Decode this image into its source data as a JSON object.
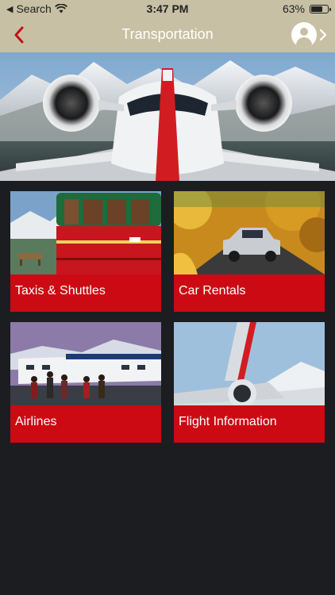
{
  "status_bar": {
    "back_app": "Search",
    "time": "3:47 PM",
    "battery_percent": "63%",
    "battery_level": 0.63
  },
  "nav": {
    "title": "Transportation"
  },
  "icons": {
    "back": "chevron-left-icon",
    "profile": "user-icon",
    "profile_arrow": "chevron-right-icon",
    "wifi": "wifi-icon",
    "battery": "battery-icon"
  },
  "colors": {
    "nav_background": "#c8c0a4",
    "accent_red": "#cc0a13",
    "page_background": "#1b1d20"
  },
  "tiles": [
    {
      "label": "Taxis & Shuttles"
    },
    {
      "label": "Car Rentals"
    },
    {
      "label": "Airlines"
    },
    {
      "label": "Flight Information"
    }
  ]
}
